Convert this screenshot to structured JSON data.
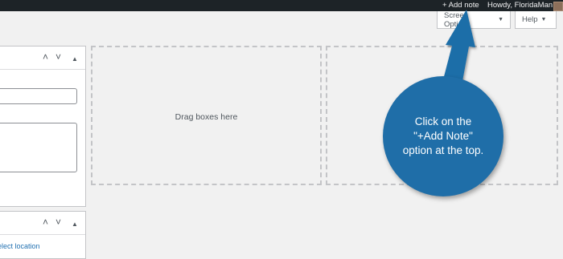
{
  "adminbar": {
    "add_note": "+ Add note",
    "howdy": "Howdy, FloridaMan"
  },
  "header": {
    "screen_options": "Screen Options",
    "help": "Help"
  },
  "left_panels": {
    "select_location": "elect location"
  },
  "dropzones": {
    "label": "Drag boxes here"
  },
  "callout": {
    "line1": "Click on the",
    "line2": "\"+Add Note\"",
    "line3": "option at the top."
  },
  "colors": {
    "adminbar": "#1d2327",
    "callout_blue": "#1f6ea8",
    "background": "#f1f1f1"
  }
}
